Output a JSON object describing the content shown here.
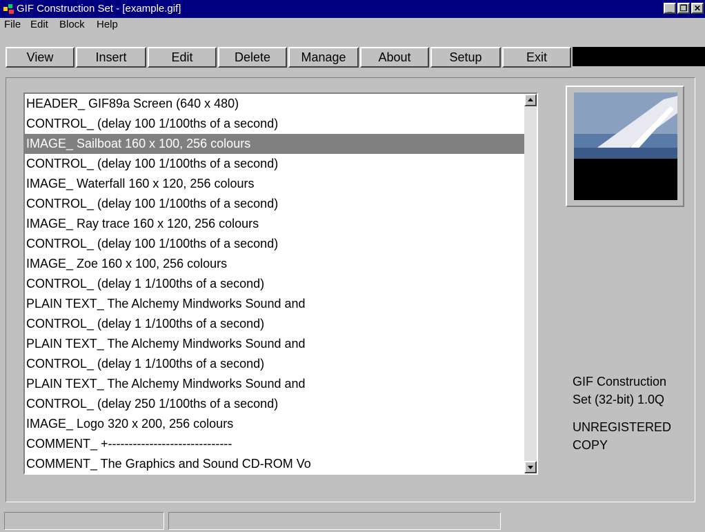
{
  "window": {
    "title": "GIF Construction Set - [example.gif]",
    "minimize_label": "_",
    "maximize_label": "❒",
    "close_label": "✕"
  },
  "menu": [
    "File",
    "Edit",
    "Block",
    "Help"
  ],
  "toolbar": [
    "View",
    "Insert",
    "Edit",
    "Delete",
    "Manage",
    "About",
    "Setup",
    "Exit"
  ],
  "blocks": [
    "HEADER_ GIF89a Screen (640 x 480)",
    "CONTROL_ (delay 100 1/100ths of a second)",
    "IMAGE_ Sailboat 160 x 100, 256 colours",
    "CONTROL_ (delay 100 1/100ths of a second)",
    "IMAGE_ Waterfall 160 x 120, 256 colours",
    "CONTROL_ (delay 100 1/100ths of a second)",
    "IMAGE_ Ray trace 160 x 120, 256 colours",
    "CONTROL_ (delay 100 1/100ths of a second)",
    "IMAGE_ Zoe 160 x 100, 256 colours",
    "CONTROL_ (delay 1 1/100ths of a second)",
    "PLAIN TEXT_ The Alchemy Mindworks Sound and",
    "CONTROL_ (delay 1 1/100ths of a second)",
    "PLAIN TEXT_ The Alchemy Mindworks Sound and",
    "CONTROL_ (delay 1 1/100ths of a second)",
    "PLAIN TEXT_ The Alchemy Mindworks Sound and",
    "CONTROL_ (delay 250 1/100ths of a second)",
    "IMAGE_ Logo 320 x 200, 256 colours",
    "COMMENT_ +------------------------------",
    "COMMENT_ The Graphics and Sound CD-ROM Vo"
  ],
  "selected_index": 2,
  "info": {
    "line1": "GIF Construction",
    "line2": "Set (32-bit) 1.0Q",
    "line3": "UNREGISTERED",
    "line4": "COPY"
  },
  "colors": {
    "titlebar": "#000080",
    "selection": "#808080",
    "face": "#c0c0c0"
  }
}
